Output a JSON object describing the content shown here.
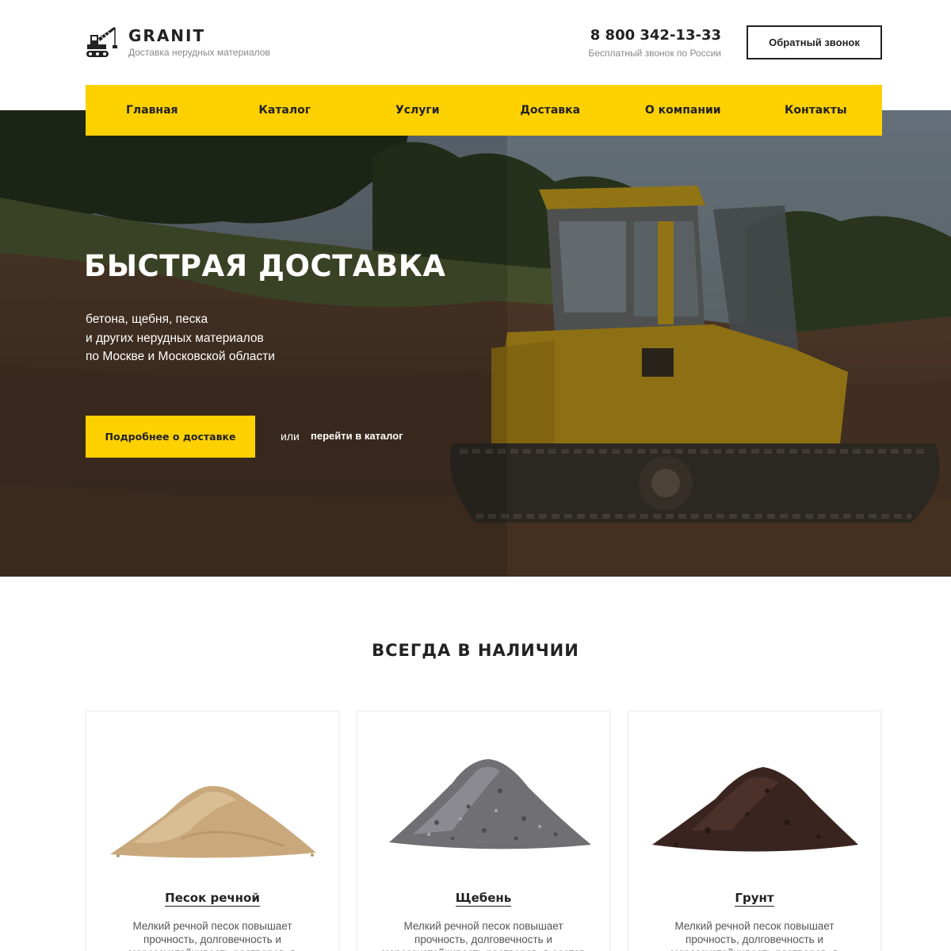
{
  "header": {
    "logo_name": "GRANIT",
    "logo_tagline": "Доставка нерудных материалов",
    "phone": "8 800 342-13-33",
    "phone_note": "Бесплатный звонок по России",
    "callback_label": "Обратный звонок"
  },
  "nav": {
    "items": [
      {
        "label": "Главная"
      },
      {
        "label": "Каталог"
      },
      {
        "label": "Услуги"
      },
      {
        "label": "Доставка"
      },
      {
        "label": "О компании"
      },
      {
        "label": "Контакты"
      }
    ]
  },
  "hero": {
    "title": "БЫСТРАЯ ДОСТАВКА",
    "subtitle_lines": [
      "бетона, щебня, песка",
      "и других нерудных материалов",
      "по Москве и Московской области"
    ],
    "primary_button": "Подробнее о доставке",
    "or_text": "или",
    "catalog_link": "перейти в каталог"
  },
  "section": {
    "title": "ВСЕГДА В НАЛИЧИИ"
  },
  "products": [
    {
      "name": "Песок речной",
      "description": "Мелкий речной песок повышает прочность, долговечность и морозоустойчивость растворов, в",
      "image": "sand-pile",
      "color": "#c9a97c"
    },
    {
      "name": "Щебень",
      "description": "Мелкий речной песок повышает прочность, долговечность и морозоустойчивость растворов, в состав которых он входит",
      "image": "gravel-pile",
      "color": "#6f6f74"
    },
    {
      "name": "Грунт",
      "description": "Мелкий речной песок повышает прочность, долговечность и морозоустойчивость растворов, в",
      "image": "soil-pile",
      "color": "#3a2420"
    }
  ],
  "colors": {
    "accent": "#fdd000",
    "text": "#222222",
    "muted": "#888888"
  }
}
